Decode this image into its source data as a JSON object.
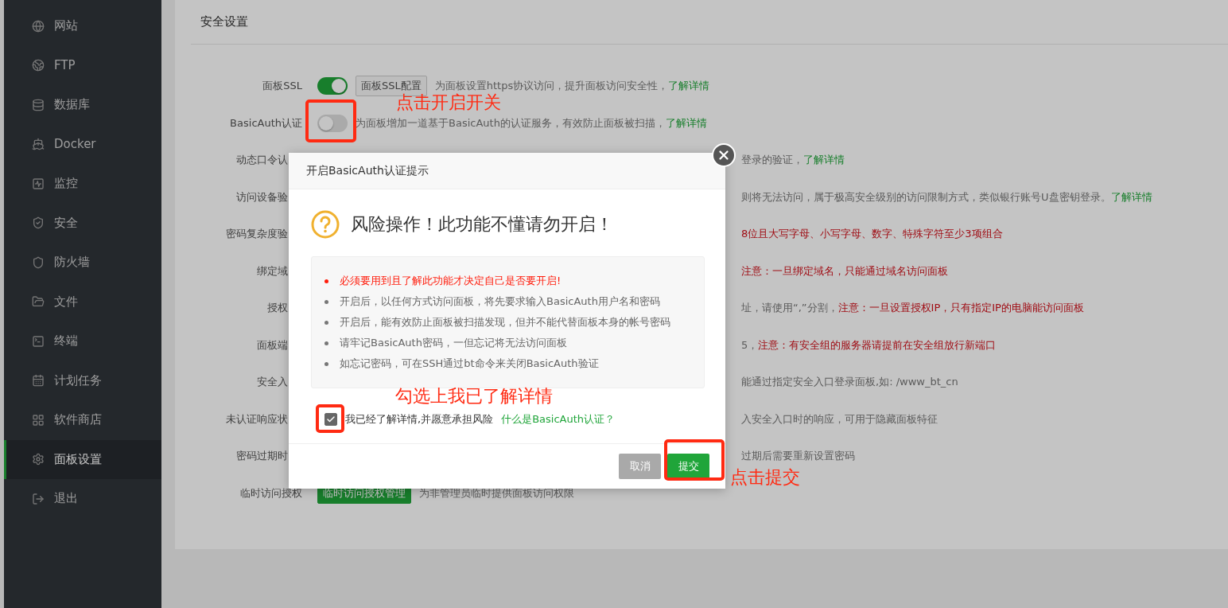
{
  "sidebar": {
    "items": [
      {
        "label": "网站",
        "selected": false
      },
      {
        "label": "FTP",
        "selected": false
      },
      {
        "label": "数据库",
        "selected": false
      },
      {
        "label": "Docker",
        "selected": false
      },
      {
        "label": "监控",
        "selected": false
      },
      {
        "label": "安全",
        "selected": false
      },
      {
        "label": "防火墙",
        "selected": false
      },
      {
        "label": "文件",
        "selected": false
      },
      {
        "label": "终端",
        "selected": false
      },
      {
        "label": "计划任务",
        "selected": false
      },
      {
        "label": "软件商店",
        "selected": false
      },
      {
        "label": "面板设置",
        "selected": true
      },
      {
        "label": "退出",
        "selected": false
      }
    ]
  },
  "section_title": "安全设置",
  "settings": [
    {
      "kind": "full",
      "label": "面板SSL",
      "switch": {
        "on": true
      },
      "button": {
        "label": "面板SSL配置",
        "kind": "default"
      },
      "description": [
        {
          "kind": "plain",
          "text": "为面板设置https协议访问，提升面板访问安全性，"
        },
        {
          "kind": "link",
          "text": "了解详情"
        }
      ]
    },
    {
      "kind": "full",
      "label": "BasicAuth认证",
      "switch": {
        "on": false
      },
      "description": [
        {
          "kind": "plain",
          "text": "为面板增加一道基于BasicAuth的认证服务，有效防止面板被扫描，"
        },
        {
          "kind": "link",
          "text": "了解详情"
        }
      ]
    },
    {
      "kind": "covered",
      "label": "动态口令认",
      "description": [
        {
          "kind": "plain",
          "text": "登录的验证，"
        },
        {
          "kind": "link",
          "text": "了解详情"
        }
      ]
    },
    {
      "kind": "covered",
      "label": "访问设备验",
      "description": [
        {
          "kind": "plain",
          "text": "则将无法访问，属于极高安全级别的访问限制方式，类似银行账号U盘密钥登录。"
        },
        {
          "kind": "link",
          "text": "了解详情"
        }
      ]
    },
    {
      "kind": "covered",
      "label": "密码复杂度验",
      "description": [
        {
          "kind": "warning",
          "text": "8位且大写字母、小写字母、数字、特殊字符至少3项组合"
        }
      ]
    },
    {
      "kind": "covered",
      "label": "绑定域",
      "description": [
        {
          "kind": "warning",
          "text": "注意：一旦绑定域名，只能通过域名访问面板"
        }
      ]
    },
    {
      "kind": "covered",
      "label": "授权",
      "description": [
        {
          "kind": "plain",
          "text": "址，请使用“,”分割，"
        },
        {
          "kind": "warning",
          "text": "注意：一旦设置授权IP，只有指定IP的电脑能访问面板"
        }
      ]
    },
    {
      "kind": "covered",
      "label": "面板端",
      "description": [
        {
          "kind": "plain",
          "text": "5，"
        },
        {
          "kind": "warning",
          "text": "注意：有安全组的服务器请提前在安全组放行新端口"
        }
      ]
    },
    {
      "kind": "covered",
      "label": "安全入",
      "description": [
        {
          "kind": "plain",
          "text": "能通过指定安全入口登录面板,如: /www_bt_cn"
        }
      ]
    },
    {
      "kind": "covered",
      "label": "未认证响应状",
      "description": [
        {
          "kind": "plain",
          "text": "入安全入口时的响应，可用于隐藏面板特征"
        }
      ]
    },
    {
      "kind": "covered",
      "label": "密码过期时",
      "description": [
        {
          "kind": "plain",
          "text": "过期后需要重新设置密码"
        }
      ]
    },
    {
      "kind": "full",
      "label": "临时访问授权",
      "button": {
        "label": "临时访问授权管理",
        "kind": "primary"
      },
      "description": [
        {
          "kind": "plain",
          "text": "为非管理员临时提供面板访问权限"
        }
      ]
    }
  ],
  "modal": {
    "title": "开启BasicAuth认证提示",
    "heading": "风险操作！此功能不懂请勿开启！",
    "notes": [
      {
        "kind": "warning",
        "text": "必须要用到且了解此功能才决定自己是否要开启!"
      },
      {
        "kind": "plain",
        "text": "开启后，以任何方式访问面板，将先要求输入BasicAuth用户名和密码"
      },
      {
        "kind": "plain",
        "text": "开启后，能有效防止面板被扫描发现，但并不能代替面板本身的帐号密码"
      },
      {
        "kind": "plain",
        "text": "请牢记BasicAuth密码，一但忘记将无法访问面板"
      },
      {
        "kind": "plain",
        "text": "如忘记密码，可在SSH通过bt命令来关闭BasicAuth验证"
      }
    ],
    "agreement": {
      "checked": true,
      "label": "我已经了解详情,并愿意承担风险",
      "link": "什么是BasicAuth认证？"
    },
    "buttons": [
      {
        "label": "取消",
        "kind": "secondary"
      },
      {
        "label": "提交",
        "kind": "primary"
      }
    ]
  },
  "annotations": [
    {
      "text": "点击开启开关"
    },
    {
      "text": "勾选上我已了解详情"
    },
    {
      "text": "点击提交"
    }
  ]
}
